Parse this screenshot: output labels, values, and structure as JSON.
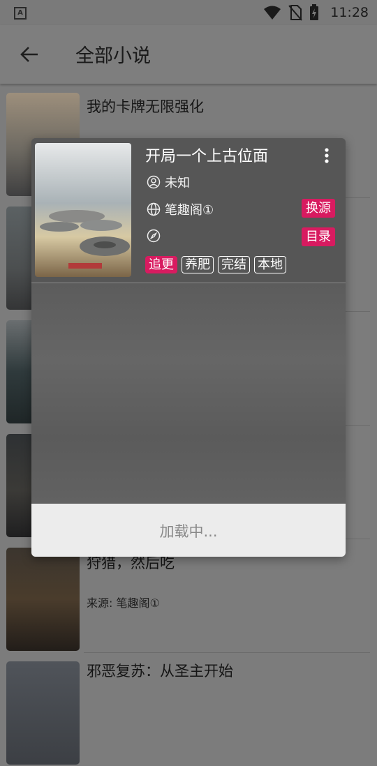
{
  "status_bar": {
    "time": "11:28",
    "app_badge": "A"
  },
  "toolbar": {
    "title": "全部小说"
  },
  "books": [
    {
      "title": "我的卡牌无限强化",
      "source": ""
    },
    {
      "title": "开局一个上古位面",
      "source": ""
    },
    {
      "title": "",
      "source": ""
    },
    {
      "title": "",
      "source": ""
    },
    {
      "title": "狩猎，然后吃",
      "source": "来源: 笔趣阁①"
    },
    {
      "title": "邪恶复苏：从圣主开始",
      "source": ""
    }
  ],
  "dialog": {
    "title": "开局一个上古位面",
    "author": "未知",
    "source": "笔趣阁①",
    "change_source_label": "换源",
    "toc_label": "目录",
    "tags": [
      "追更",
      "养肥",
      "完结",
      "本地"
    ],
    "active_tag": "追更",
    "loading_text": "加载中..."
  },
  "colors": {
    "accent": "#d81b60",
    "scrim": "rgba(0,0,0,0.5)"
  },
  "icons": [
    "back-arrow-icon",
    "wifi-icon",
    "no-sim-icon",
    "battery-icon",
    "person-icon",
    "globe-icon",
    "compass-icon",
    "more-vert-icon"
  ]
}
